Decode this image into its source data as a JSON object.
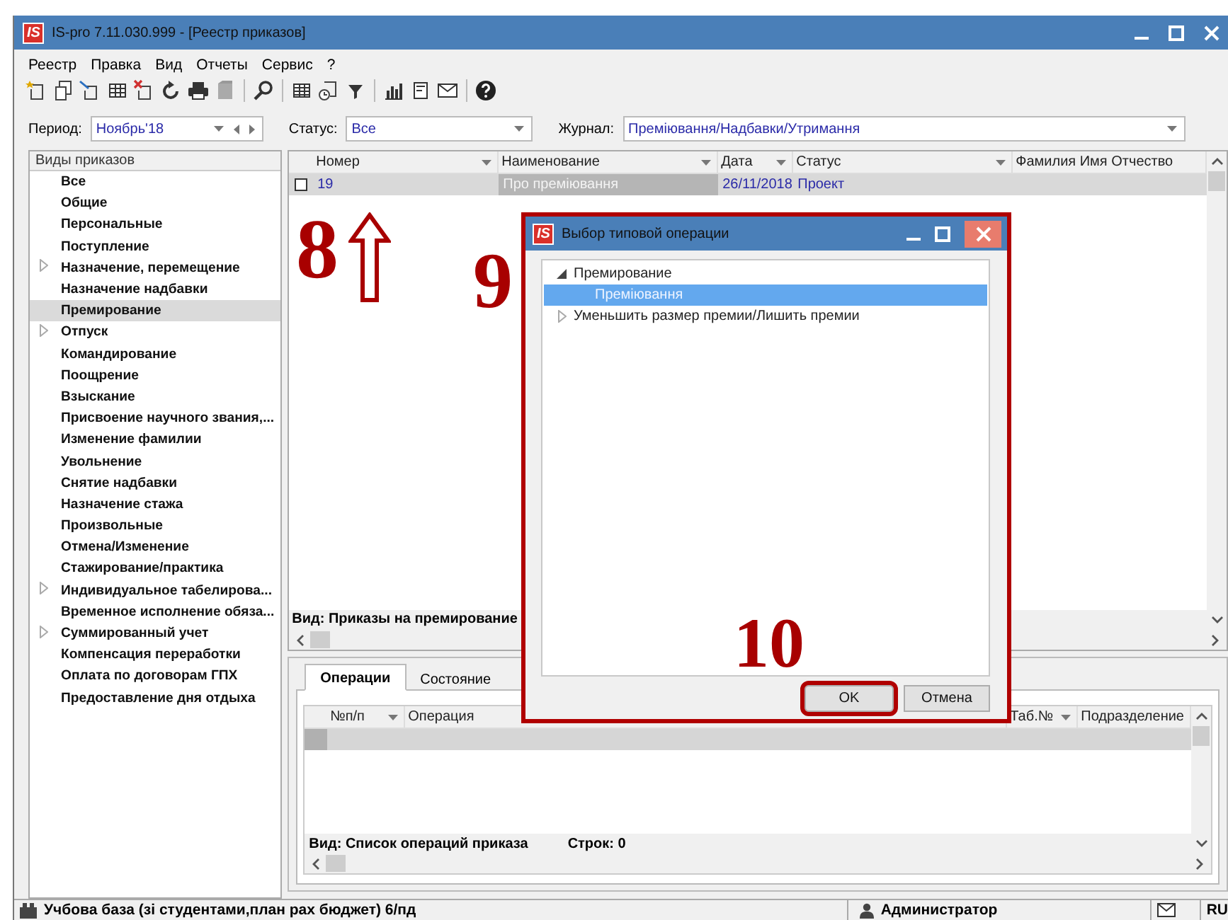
{
  "window": {
    "logo": "IS",
    "title": "IS-pro 7.11.030.999 - [Реестр приказов]"
  },
  "menu": [
    "Реестр",
    "Правка",
    "Вид",
    "Отчеты",
    "Сервис",
    "?"
  ],
  "filters": [
    {
      "label": "Период:",
      "value": "Ноябрь'18",
      "kind": "period"
    },
    {
      "label": "Статус:",
      "value": "Все",
      "kind": "combo"
    },
    {
      "label": "Журнал:",
      "value": "Преміювання/Надбавки/Утримання",
      "kind": "combo"
    }
  ],
  "sidebar": {
    "title": "Виды приказов",
    "items": [
      {
        "label": "Все",
        "kind": "item",
        "selected": false
      },
      {
        "label": "Общие",
        "kind": "item",
        "selected": false
      },
      {
        "label": "Персональные",
        "kind": "item",
        "selected": false
      },
      {
        "label": "Поступление",
        "kind": "item",
        "selected": false
      },
      {
        "label": "Назначение, перемещение",
        "kind": "group",
        "selected": false
      },
      {
        "label": "Назначение надбавки",
        "kind": "item",
        "selected": false
      },
      {
        "label": "Премирование",
        "kind": "item",
        "selected": true
      },
      {
        "label": "Отпуск",
        "kind": "group",
        "selected": false
      },
      {
        "label": "Командирование",
        "kind": "item",
        "selected": false
      },
      {
        "label": "Поощрение",
        "kind": "item",
        "selected": false
      },
      {
        "label": "Взыскание",
        "kind": "item",
        "selected": false
      },
      {
        "label": "Присвоение научного звания,...",
        "kind": "item",
        "selected": false
      },
      {
        "label": "Изменение фамилии",
        "kind": "item",
        "selected": false
      },
      {
        "label": "Увольнение",
        "kind": "item",
        "selected": false
      },
      {
        "label": "Снятие надбавки",
        "kind": "item",
        "selected": false
      },
      {
        "label": "Назначение стажа",
        "kind": "item",
        "selected": false
      },
      {
        "label": "Произвольные",
        "kind": "item",
        "selected": false
      },
      {
        "label": "Отмена/Изменение",
        "kind": "item",
        "selected": false
      },
      {
        "label": "Стажирование/практика",
        "kind": "item",
        "selected": false
      },
      {
        "label": "Индивидуальное табелирова...",
        "kind": "group",
        "selected": false
      },
      {
        "label": "Временное исполнение обяза...",
        "kind": "item",
        "selected": false
      },
      {
        "label": "Суммированный учет",
        "kind": "group",
        "selected": false
      },
      {
        "label": "Компенсация переработки",
        "kind": "item",
        "selected": false
      },
      {
        "label": "Оплата по договорам ГПХ",
        "kind": "item",
        "selected": false
      },
      {
        "label": "Предоставление дня отдыха",
        "kind": "item",
        "selected": false
      }
    ]
  },
  "table": {
    "columns": [
      {
        "label": "Номер",
        "filter": true
      },
      {
        "label": "Наименование",
        "filter": true
      },
      {
        "label": "Дата",
        "filter": true
      },
      {
        "label": "Статус",
        "filter": true
      },
      {
        "label": "Фамилия Имя Отчество",
        "filter": false
      }
    ],
    "rows": [
      {
        "checked": false,
        "selected": true,
        "cells": [
          {
            "text": "19",
            "focused": false
          },
          {
            "text": "Про преміювання",
            "focused": true
          },
          {
            "text": "26/11/2018",
            "focused": false
          },
          {
            "text": "Проект",
            "focused": false
          }
        ]
      }
    ],
    "footer": "Вид: Приказы на премирование"
  },
  "detail": {
    "tabs": [
      {
        "label": "Операции",
        "selected": true
      },
      {
        "label": "Состояние",
        "selected": false
      }
    ],
    "columns": [
      {
        "label": "№п/п",
        "filter": true
      },
      {
        "label": "Операция",
        "filter": false
      },
      {
        "label": "Таб.№",
        "filter": true
      },
      {
        "label": "Подразделение",
        "filter": false
      }
    ],
    "footer": [
      "Вид: Список операций приказа",
      "Строк: 0"
    ]
  },
  "status_bar": {
    "database": "Учбова база (зі студентами,план рах бюджет) 6/пд",
    "user": "Администратор",
    "language": "RU"
  },
  "dialog": {
    "logo": "IS",
    "title": "Выбор типовой операции",
    "tree": [
      {
        "label": "Премирование",
        "expanded": true,
        "selected": false,
        "children": [
          {
            "label": "Преміювання",
            "selected": true
          }
        ]
      },
      {
        "label": "Уменьшить размер премии/Лишить премии",
        "expanded": false,
        "selected": false
      }
    ],
    "buttons": [
      {
        "label": "OK",
        "highlighted": true
      },
      {
        "label": "Отмена",
        "highlighted": false
      }
    ]
  },
  "annotations": [
    {
      "text": "8",
      "kind": "arrow"
    },
    {
      "text": "9",
      "kind": "plain"
    },
    {
      "text": "10",
      "kind": "plain"
    }
  ]
}
